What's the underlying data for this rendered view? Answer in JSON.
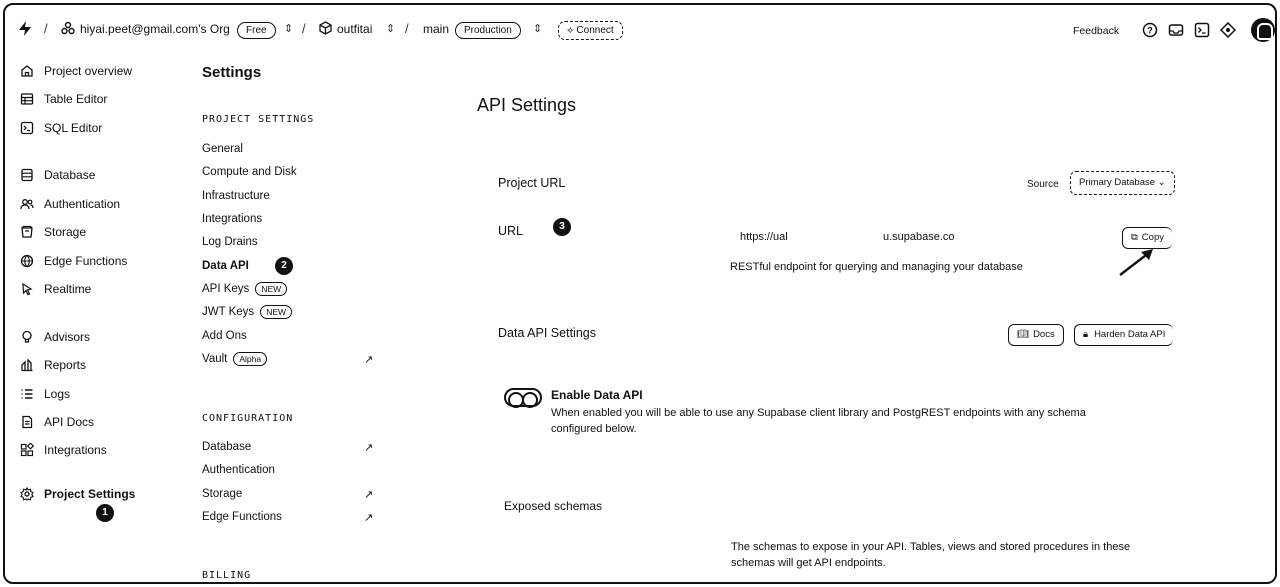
{
  "topbar": {
    "org": "hiyai.peet@gmail.com's Org",
    "plan_badge": "Free",
    "project": "outfitai",
    "branch": "main",
    "env_badge": "Production",
    "connect": "Connect",
    "feedback": "Feedback",
    "separator": "/"
  },
  "nav": [
    {
      "label": "Project overview",
      "icon": "home-icon"
    },
    {
      "label": "Table Editor",
      "icon": "table-icon"
    },
    {
      "label": "SQL Editor",
      "icon": "terminal-icon"
    },
    {
      "label": "Database",
      "icon": "database-icon"
    },
    {
      "label": "Authentication",
      "icon": "users-icon"
    },
    {
      "label": "Storage",
      "icon": "archive-icon"
    },
    {
      "label": "Edge Functions",
      "icon": "globe-icon"
    },
    {
      "label": "Realtime",
      "icon": "pointer-icon"
    },
    {
      "label": "Advisors",
      "icon": "lightbulb-icon"
    },
    {
      "label": "Reports",
      "icon": "chart-icon"
    },
    {
      "label": "Logs",
      "icon": "list-icon"
    },
    {
      "label": "API Docs",
      "icon": "doc-icon"
    },
    {
      "label": "Integrations",
      "icon": "blocks-icon"
    },
    {
      "label": "Project Settings",
      "icon": "gear-icon"
    }
  ],
  "settings": {
    "title": "Settings",
    "project_settings_header": "PROJECT SETTINGS",
    "project_items": [
      {
        "label": "General",
        "badge": null
      },
      {
        "label": "Compute and Disk",
        "badge": null
      },
      {
        "label": "Infrastructure",
        "badge": null
      },
      {
        "label": "Integrations",
        "badge": null
      },
      {
        "label": "Log Drains",
        "badge": null
      },
      {
        "label": "Data API",
        "badge": null
      },
      {
        "label": "API Keys",
        "badge": "NEW"
      },
      {
        "label": "JWT Keys",
        "badge": "NEW"
      },
      {
        "label": "Add Ons",
        "badge": null
      },
      {
        "label": "Vault",
        "badge": "Alpha"
      }
    ],
    "configuration_header": "CONFIGURATION",
    "config_items": [
      {
        "label": "Database"
      },
      {
        "label": "Authentication"
      },
      {
        "label": "Storage"
      },
      {
        "label": "Edge Functions"
      }
    ],
    "billing_header": "BILLING",
    "external_glyph": "↗"
  },
  "markers": {
    "one": "1",
    "two": "2",
    "three": "3"
  },
  "main": {
    "title": "API Settings",
    "project_url": {
      "heading": "Project URL",
      "source_label": "Source",
      "source_value": "Primary Database",
      "url_label": "URL",
      "url_left": "https://ual",
      "url_right": "u.supabase.co",
      "copy": "Copy",
      "endpoint_desc": "RESTful endpoint for querying and managing your database"
    },
    "data_api": {
      "heading": "Data API Settings",
      "docs": "Docs",
      "harden": "Harden Data API",
      "enable_label": "Enable Data API",
      "enable_desc_1": "When enabled you will be able to use any Supabase client library and PostgREST endpoints with any schema",
      "enable_desc_2": "configured below.",
      "exposed_label": "Exposed schemas",
      "exposed_desc_1": "The schemas to expose in your API. Tables, views and stored procedures in these",
      "exposed_desc_2": "schemas will get API endpoints."
    }
  }
}
